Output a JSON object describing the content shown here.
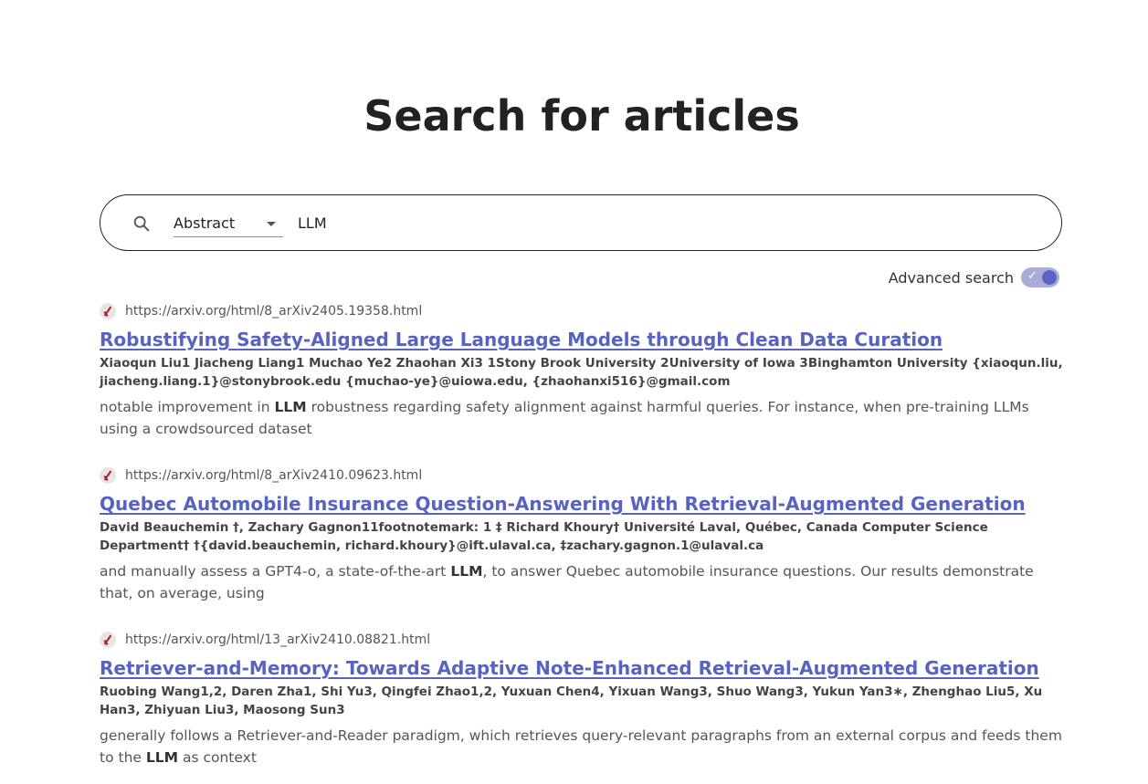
{
  "page": {
    "title": "Search for articles"
  },
  "search": {
    "icon": "search-icon",
    "field_selected": "Abstract",
    "query": "LLM"
  },
  "advanced_search": {
    "label": "Advanced search",
    "enabled": true,
    "check_glyph": "✓"
  },
  "colors": {
    "accent": "#5862c0",
    "toggle_track": "#a9acd9",
    "toggle_knob": "#5b62c4"
  },
  "results": [
    {
      "site_icon": "arxiv-icon",
      "url": "https://arxiv.org/html/8_arXiv2405.19358.html",
      "title": "Robustifying Safety-Aligned Large Language Models through Clean Data Curation",
      "authors": "Xiaoqun Liu1     Jiacheng Liang1     Muchao Ye2     Zhaohan Xi3 1Stony Brook University  2University of Iowa   3Binghamton University {xiaoqun.liu, jiacheng.liang.1}@stonybrook.edu {muchao-ye}@uiowa.edu, {zhaohanxi516}@gmail.com",
      "snippet_before": "notable improvement in ",
      "snippet_highlight": "LLM",
      "snippet_after": " robustness regarding safety alignment against harmful queries. For instance, when pre-training LLMs using a crowdsourced dataset"
    },
    {
      "site_icon": "arxiv-icon",
      "url": "https://arxiv.org/html/8_arXiv2410.09623.html",
      "title": "Quebec Automobile Insurance Question-Answering With Retrieval-Augmented Generation",
      "authors": "David Beauchemin  †, Zachary Gagnon11footnotemark: 1 ‡ Richard Khoury† Université Laval, Québec, Canada Computer Science Department† †{david.beauchemin, richard.khoury}@ift.ulaval.ca, ‡zachary.gagnon.1@ulaval.ca",
      "snippet_before": "and manually assess a GPT4-o, a state-of-the-art ",
      "snippet_highlight": "LLM",
      "snippet_after": ", to answer Quebec automobile insurance questions. Our results demonstrate that, on average, using"
    },
    {
      "site_icon": "arxiv-icon",
      "url": "https://arxiv.org/html/13_arXiv2410.08821.html",
      "title": "Retriever-and-Memory: Towards Adaptive Note-Enhanced Retrieval-Augmented Generation",
      "authors": "Ruobing Wang1,2, Daren Zha1, Shi Yu3, Qingfei Zhao1,2, Yuxuan Chen4, Yixuan Wang3, Shuo Wang3, Yukun Yan3∗, Zhenghao Liu5, Xu Han3, Zhiyuan Liu3, Maosong Sun3",
      "snippet_before": "generally follows a Retriever-and-Reader paradigm, which retrieves query-relevant paragraphs from an external corpus and feeds them to the ",
      "snippet_highlight": "LLM",
      "snippet_after": " as context"
    }
  ]
}
